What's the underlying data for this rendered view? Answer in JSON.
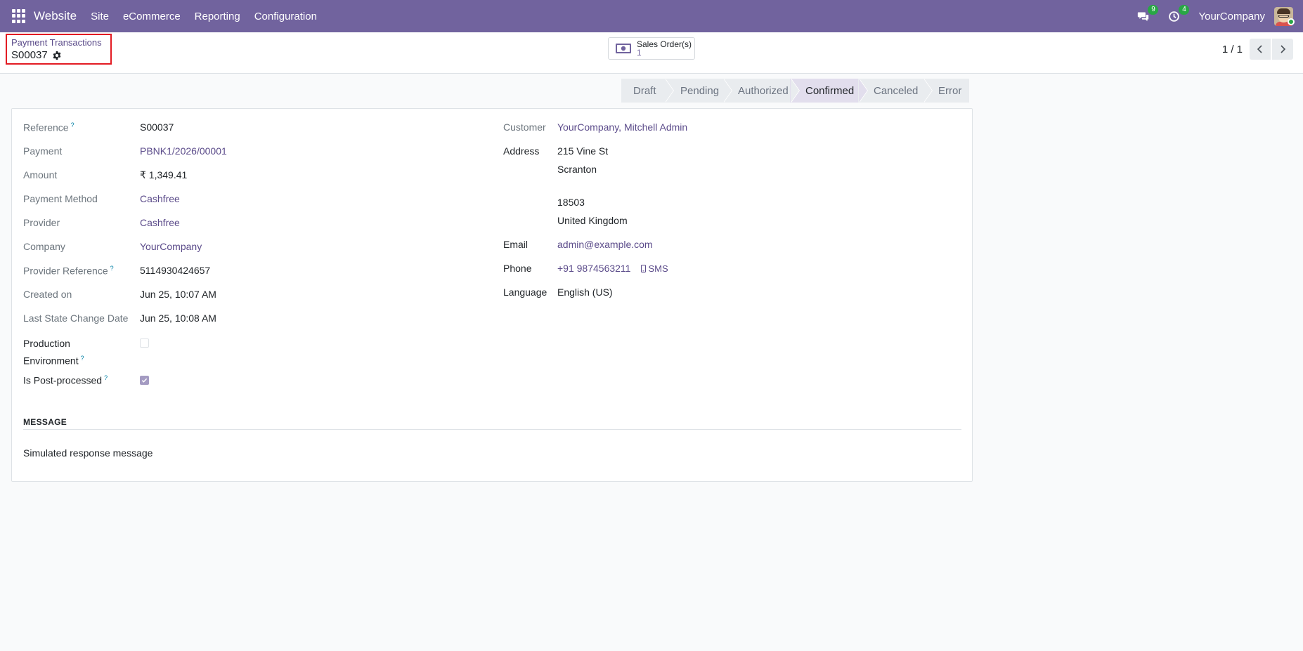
{
  "navbar": {
    "brand": "Website",
    "menu": [
      "Site",
      "eCommerce",
      "Reporting",
      "Configuration"
    ],
    "messages_count": "9",
    "activities_count": "4",
    "company": "YourCompany"
  },
  "breadcrumb": {
    "parent": "Payment Transactions",
    "current": "S00037"
  },
  "smart_button": {
    "label": "Sales Order(s)",
    "count": "1"
  },
  "pager": {
    "value": "1 / 1"
  },
  "statusbar": {
    "stages": [
      "Draft",
      "Pending",
      "Authorized",
      "Confirmed",
      "Canceled",
      "Error"
    ],
    "active": "Confirmed"
  },
  "form": {
    "left": {
      "reference_label": "Reference",
      "reference": "S00037",
      "payment_label": "Payment",
      "payment": "PBNK1/2026/00001",
      "amount_label": "Amount",
      "amount": "₹ 1,349.41",
      "payment_method_label": "Payment Method",
      "payment_method": "Cashfree",
      "provider_label": "Provider",
      "provider": "Cashfree",
      "company_label": "Company",
      "company": "YourCompany",
      "provider_reference_label": "Provider Reference",
      "provider_reference": "5114930424657",
      "created_on_label": "Created on",
      "created_on": "Jun 25, 10:07 AM",
      "last_state_change_label": "Last State Change Date",
      "last_state_change": "Jun 25, 10:08 AM",
      "production_env_label_1": "Production",
      "production_env_label_2": "Environment",
      "production_env": false,
      "post_processed_label": "Is Post-processed",
      "post_processed": true
    },
    "right": {
      "customer_label": "Customer",
      "customer": "YourCompany, Mitchell Admin",
      "address_label": "Address",
      "address_line1": "215 Vine St",
      "address_city": "Scranton",
      "address_zip": "18503",
      "address_country": "United Kingdom",
      "email_label": "Email",
      "email": "admin@example.com",
      "phone_label": "Phone",
      "phone": "+91 9874563211",
      "sms_label": "SMS",
      "language_label": "Language",
      "language": "English (US)"
    },
    "message_section": {
      "title": "MESSAGE",
      "text": "Simulated response message"
    },
    "help_mark": "?"
  }
}
